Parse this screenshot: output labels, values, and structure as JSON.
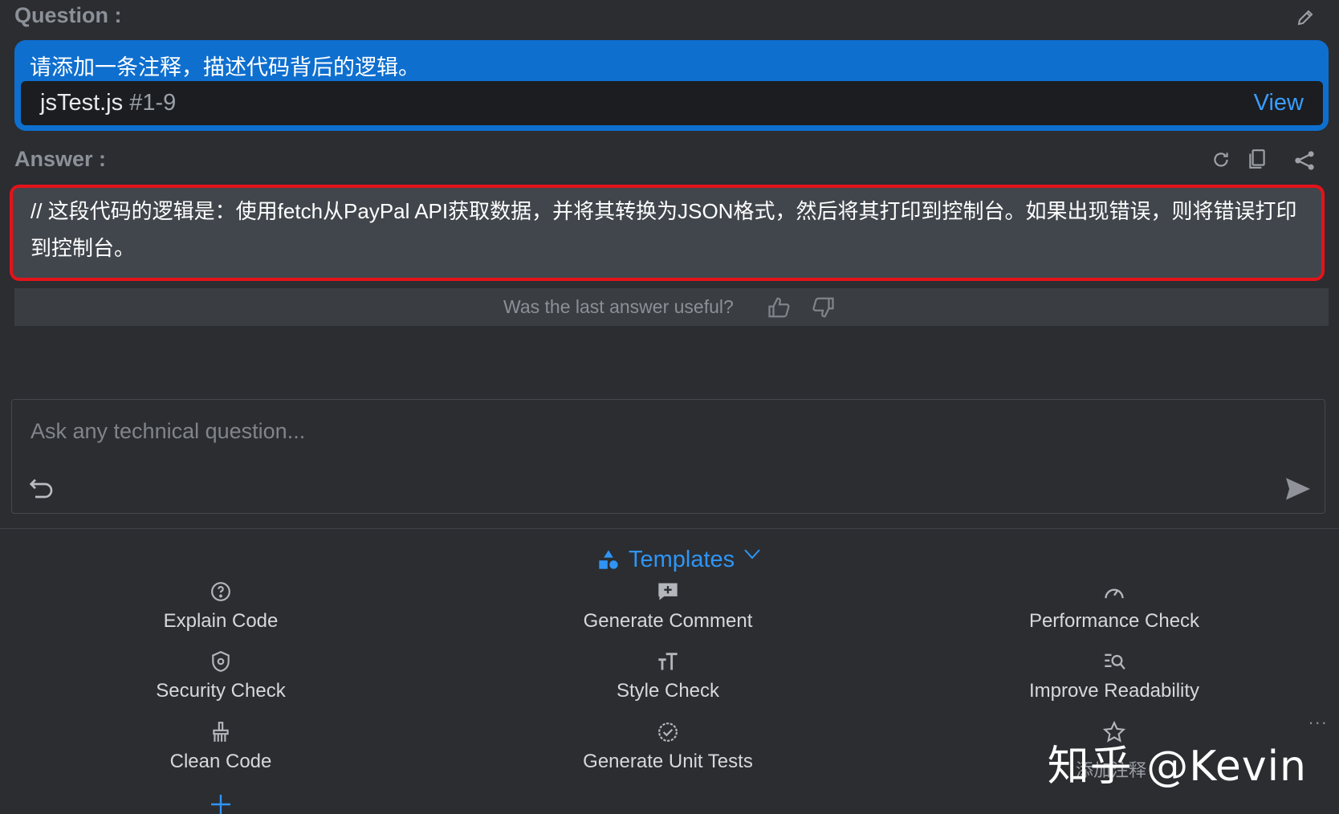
{
  "question": {
    "label": "Question :",
    "text": "请添加一条注释，描述代码背后的逻辑。",
    "file_name": "jsTest.js",
    "file_range": "#1-9",
    "view_label": "View"
  },
  "answer": {
    "label": "Answer :",
    "text": "// 这段代码的逻辑是：使用fetch从PayPal API获取数据，并将其转换为JSON格式，然后将其打印到控制台。如果出现错误，则将错误打印到控制台。"
  },
  "feedback": {
    "text": "Was the last answer useful?"
  },
  "input": {
    "placeholder": "Ask any technical question..."
  },
  "templates": {
    "title": "Templates",
    "items": [
      {
        "label": "Explain Code",
        "icon": "question-circle-icon"
      },
      {
        "label": "Generate Comment",
        "icon": "comment-plus-icon"
      },
      {
        "label": "Performance Check",
        "icon": "gauge-icon"
      },
      {
        "label": "Security Check",
        "icon": "shield-icon"
      },
      {
        "label": "Style Check",
        "icon": "text-size-icon"
      },
      {
        "label": "Improve Readability",
        "icon": "search-list-icon"
      },
      {
        "label": "Clean Code",
        "icon": "broom-icon"
      },
      {
        "label": "Generate Unit Tests",
        "icon": "check-circle-icon"
      },
      {
        "label": "添加注释",
        "icon": "star-icon"
      }
    ],
    "more": "..."
  },
  "watermark": {
    "text": "知乎 @Kevin"
  },
  "colors": {
    "accent": "#0e6fcf",
    "link": "#3a9dff",
    "highlight_border": "#e3131a",
    "background": "#2b2d31"
  }
}
